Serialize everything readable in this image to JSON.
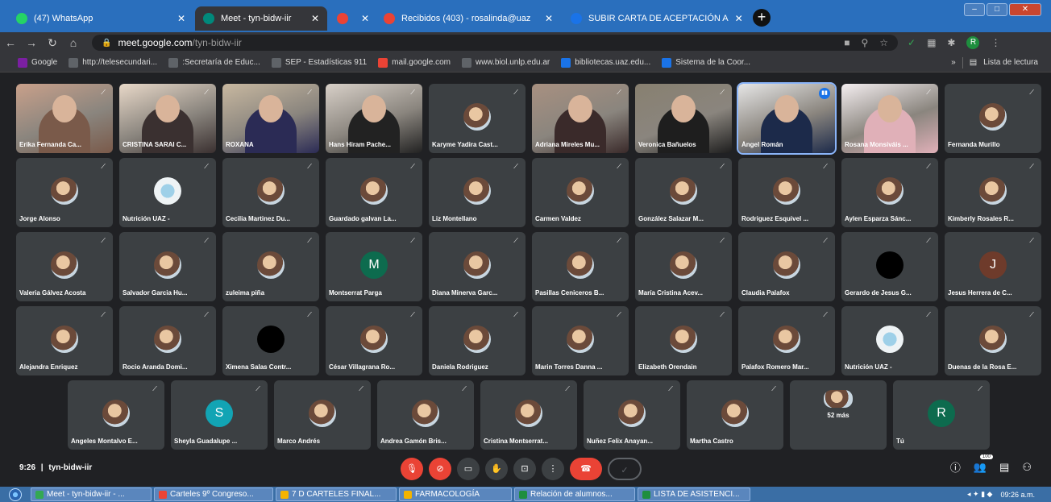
{
  "browser": {
    "tabs": [
      {
        "title": "(47) WhatsApp",
        "favicon": "whatsapp-icon",
        "color": "#25d366",
        "active": false
      },
      {
        "title": "Meet - tyn-bidw-iir",
        "favicon": "meet-icon",
        "color": "#00897b",
        "active": true
      },
      {
        "title": "",
        "favicon": "recording-icon",
        "color": "#ea4335",
        "active": false
      },
      {
        "title": "Recibidos (403) - rosalinda@uaz",
        "favicon": "gmail-icon",
        "color": "#ea4335",
        "active": false
      },
      {
        "title": "SUBIR CARTA DE ACEPTACIÓN A",
        "favicon": "doc-icon",
        "color": "#1a73e8",
        "active": false
      }
    ],
    "new_tab_label": "+",
    "address": {
      "host": "meet.google.com",
      "path": "/tyn-bidw-iir"
    },
    "profile_initial": "R",
    "bookmarks": [
      {
        "label": "Google",
        "icon": "google-icon",
        "color": "#7b1fa2"
      },
      {
        "label": "http://telesecundari...",
        "icon": "globe-icon",
        "color": "#5f6368"
      },
      {
        "label": ":Secretaría de Educ...",
        "icon": "globe-icon",
        "color": "#5f6368"
      },
      {
        "label": "SEP - Estadísticas 911",
        "icon": "globe-icon",
        "color": "#5f6368"
      },
      {
        "label": "mail.google.com",
        "icon": "gmail-icon",
        "color": "#ea4335"
      },
      {
        "label": "www.biol.unlp.edu.ar",
        "icon": "globe-icon",
        "color": "#5f6368"
      },
      {
        "label": "bibliotecas.uaz.edu...",
        "icon": "link-icon",
        "color": "#1a73e8"
      },
      {
        "label": "Sistema de la Coor...",
        "icon": "site-icon",
        "color": "#1a73e8"
      }
    ],
    "more_bookmarks": "»",
    "reading_list": "Lista de lectura"
  },
  "meet": {
    "participants_row1": [
      {
        "name": "Erika Fernanda Ca...",
        "kind": "video",
        "c1": "#7a5a4a",
        "c2": "#c9a08a"
      },
      {
        "name": "CRISTINA SARAI C...",
        "kind": "video",
        "c1": "#3a3030",
        "c2": "#e8d8c8"
      },
      {
        "name": "ROXANA",
        "kind": "video",
        "c1": "#2b2b55",
        "c2": "#c8b8a0"
      },
      {
        "name": "Hans Hiram Pache...",
        "kind": "video",
        "c1": "#222222",
        "c2": "#d8d0c8"
      },
      {
        "name": "Karyme Yadira Cast...",
        "kind": "avatar"
      },
      {
        "name": "Adriana Mireles Mu...",
        "kind": "video",
        "c1": "#3a2a2a",
        "c2": "#a89080"
      },
      {
        "name": "Veronica Bañuelos",
        "kind": "video",
        "c1": "#1e1e1e",
        "c2": "#888070"
      },
      {
        "name": "Ángel Román",
        "kind": "video",
        "c1": "#1c2a4a",
        "c2": "#e6e6e6",
        "speaking": true
      },
      {
        "name": "Rosana Monsiváis ...",
        "kind": "video",
        "c1": "#e0b0b8",
        "c2": "#f4eef0"
      },
      {
        "name": "Fernanda Murillo",
        "kind": "avatar"
      }
    ],
    "participants_row2": [
      {
        "name": "Jorge Alonso",
        "kind": "avatar"
      },
      {
        "name": "Nutrición UAZ -",
        "kind": "logo"
      },
      {
        "name": "Cecilia Martinez Du...",
        "kind": "avatar"
      },
      {
        "name": "Guardado galvan La...",
        "kind": "avatar"
      },
      {
        "name": "Liz Montellano",
        "kind": "avatar"
      },
      {
        "name": "Carmen Valdez",
        "kind": "avatar"
      },
      {
        "name": "González Salazar M...",
        "kind": "avatar"
      },
      {
        "name": "Rodriguez Esquivel ...",
        "kind": "avatar"
      },
      {
        "name": "Aylen Esparza Sánc...",
        "kind": "avatar"
      },
      {
        "name": "Kimberly Rosales R...",
        "kind": "avatar"
      }
    ],
    "participants_row3": [
      {
        "name": "Valeria Gálvez Acosta",
        "kind": "avatar"
      },
      {
        "name": "Salvador Garcia Hu...",
        "kind": "avatar"
      },
      {
        "name": "zuleima piña",
        "kind": "avatar"
      },
      {
        "name": "Montserrat Parga",
        "kind": "letter",
        "letter": "M",
        "color": "#0d6b4e"
      },
      {
        "name": "Diana Minerva Garc...",
        "kind": "avatar"
      },
      {
        "name": "Pasillas Ceniceros B...",
        "kind": "avatar"
      },
      {
        "name": "María Cristina Acev...",
        "kind": "avatar"
      },
      {
        "name": "Claudia Palafox",
        "kind": "avatar"
      },
      {
        "name": "Gerardo de Jesus G...",
        "kind": "dark"
      },
      {
        "name": "Jesus Herrera de C...",
        "kind": "letter",
        "letter": "J",
        "color": "#6e3b2b"
      }
    ],
    "participants_row4": [
      {
        "name": "Alejandra Enriquez",
        "kind": "avatar"
      },
      {
        "name": "Rocio Aranda Domi...",
        "kind": "avatar"
      },
      {
        "name": "Ximena Salas Contr...",
        "kind": "dark"
      },
      {
        "name": "César Villagrana Ro...",
        "kind": "avatar"
      },
      {
        "name": "Daniela Rodriguez",
        "kind": "avatar"
      },
      {
        "name": "Marin Torres Danna ...",
        "kind": "avatar"
      },
      {
        "name": "Elizabeth Orendain",
        "kind": "avatar"
      },
      {
        "name": "Palafox Romero Mar...",
        "kind": "avatar"
      },
      {
        "name": "Nutrición UAZ -",
        "kind": "logo"
      },
      {
        "name": "Duenas de la Rosa E...",
        "kind": "avatar"
      }
    ],
    "participants_row5": [
      {
        "name": "Angeles Montalvo E...",
        "kind": "avatar"
      },
      {
        "name": "Sheyla Guadalupe ...",
        "kind": "letter",
        "letter": "S",
        "color": "#12a4b4"
      },
      {
        "name": "Marco Andrés",
        "kind": "avatar"
      },
      {
        "name": "Andrea Gamón Bris...",
        "kind": "avatar"
      },
      {
        "name": "Cristina Montserrat...",
        "kind": "avatar"
      },
      {
        "name": "Nuñez Felix Anayan...",
        "kind": "avatar"
      },
      {
        "name": "Martha Castro",
        "kind": "avatar"
      },
      {
        "name": "52 más",
        "kind": "more"
      },
      {
        "name": "Tú",
        "kind": "letter",
        "letter": "R",
        "color": "#0d6b4e"
      }
    ],
    "time": "9:26",
    "separator": "|",
    "meeting_code": "tyn-bidw-iir",
    "people_badge": "100"
  },
  "taskbar": {
    "items": [
      {
        "label": "Meet - tyn-bidw-iir - ...",
        "color": "#34a853"
      },
      {
        "label": "Carteles 9º Congreso...",
        "color": "#ea4335"
      },
      {
        "label": "7 D CARTELES FINAL...",
        "color": "#f4b400"
      },
      {
        "label": "FARMACOLOGÍA",
        "color": "#f4b400"
      },
      {
        "label": "Relación de alumnos...",
        "color": "#1e8e3e"
      },
      {
        "label": "LISTA DE ASISTENCI...",
        "color": "#1e8e3e"
      }
    ],
    "clock": "09:26 a.m."
  }
}
